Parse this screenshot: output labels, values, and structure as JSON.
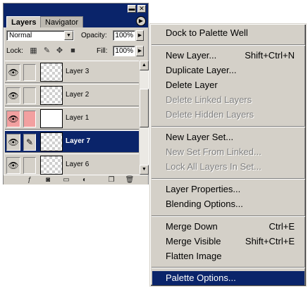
{
  "palette": {
    "tabs": [
      {
        "label": "Layers"
      },
      {
        "label": "Navigator"
      }
    ],
    "blend_mode": "Normal",
    "opacity_label": "Opacity:",
    "opacity_value": "100%",
    "lock_label": "Lock:",
    "fill_label": "Fill:",
    "fill_value": "100%",
    "layers": [
      {
        "name": "Layer 3",
        "selected": false
      },
      {
        "name": "Layer 2",
        "selected": false
      },
      {
        "name": "Layer 1",
        "selected": false
      },
      {
        "name": "Layer 7",
        "selected": true
      },
      {
        "name": "Layer 6",
        "selected": false
      }
    ],
    "colors": {
      "title_bar": "#0a246a",
      "selection": "#0a246a",
      "panel": "#d4d0c8",
      "highlight_row": "#f2a0a0"
    }
  },
  "menu": {
    "items": [
      {
        "label": "Dock to Palette Well",
        "shortcut": "",
        "enabled": true
      },
      {
        "label": "New Layer...",
        "shortcut": "Shift+Ctrl+N",
        "enabled": true
      },
      {
        "label": "Duplicate Layer...",
        "shortcut": "",
        "enabled": true
      },
      {
        "label": "Delete Layer",
        "shortcut": "",
        "enabled": true
      },
      {
        "label": "Delete Linked Layers",
        "shortcut": "",
        "enabled": false
      },
      {
        "label": "Delete Hidden Layers",
        "shortcut": "",
        "enabled": false
      },
      {
        "label": "New Layer Set...",
        "shortcut": "",
        "enabled": true
      },
      {
        "label": "New Set From Linked...",
        "shortcut": "",
        "enabled": false
      },
      {
        "label": "Lock All Layers In Set...",
        "shortcut": "",
        "enabled": false
      },
      {
        "label": "Layer Properties...",
        "shortcut": "",
        "enabled": true
      },
      {
        "label": "Blending Options...",
        "shortcut": "",
        "enabled": true
      },
      {
        "label": "Merge Down",
        "shortcut": "Ctrl+E",
        "enabled": true
      },
      {
        "label": "Merge Visible",
        "shortcut": "Shift+Ctrl+E",
        "enabled": true
      },
      {
        "label": "Flatten Image",
        "shortcut": "",
        "enabled": true
      },
      {
        "label": "Palette Options...",
        "shortcut": "",
        "enabled": true,
        "highlighted": true
      }
    ]
  }
}
